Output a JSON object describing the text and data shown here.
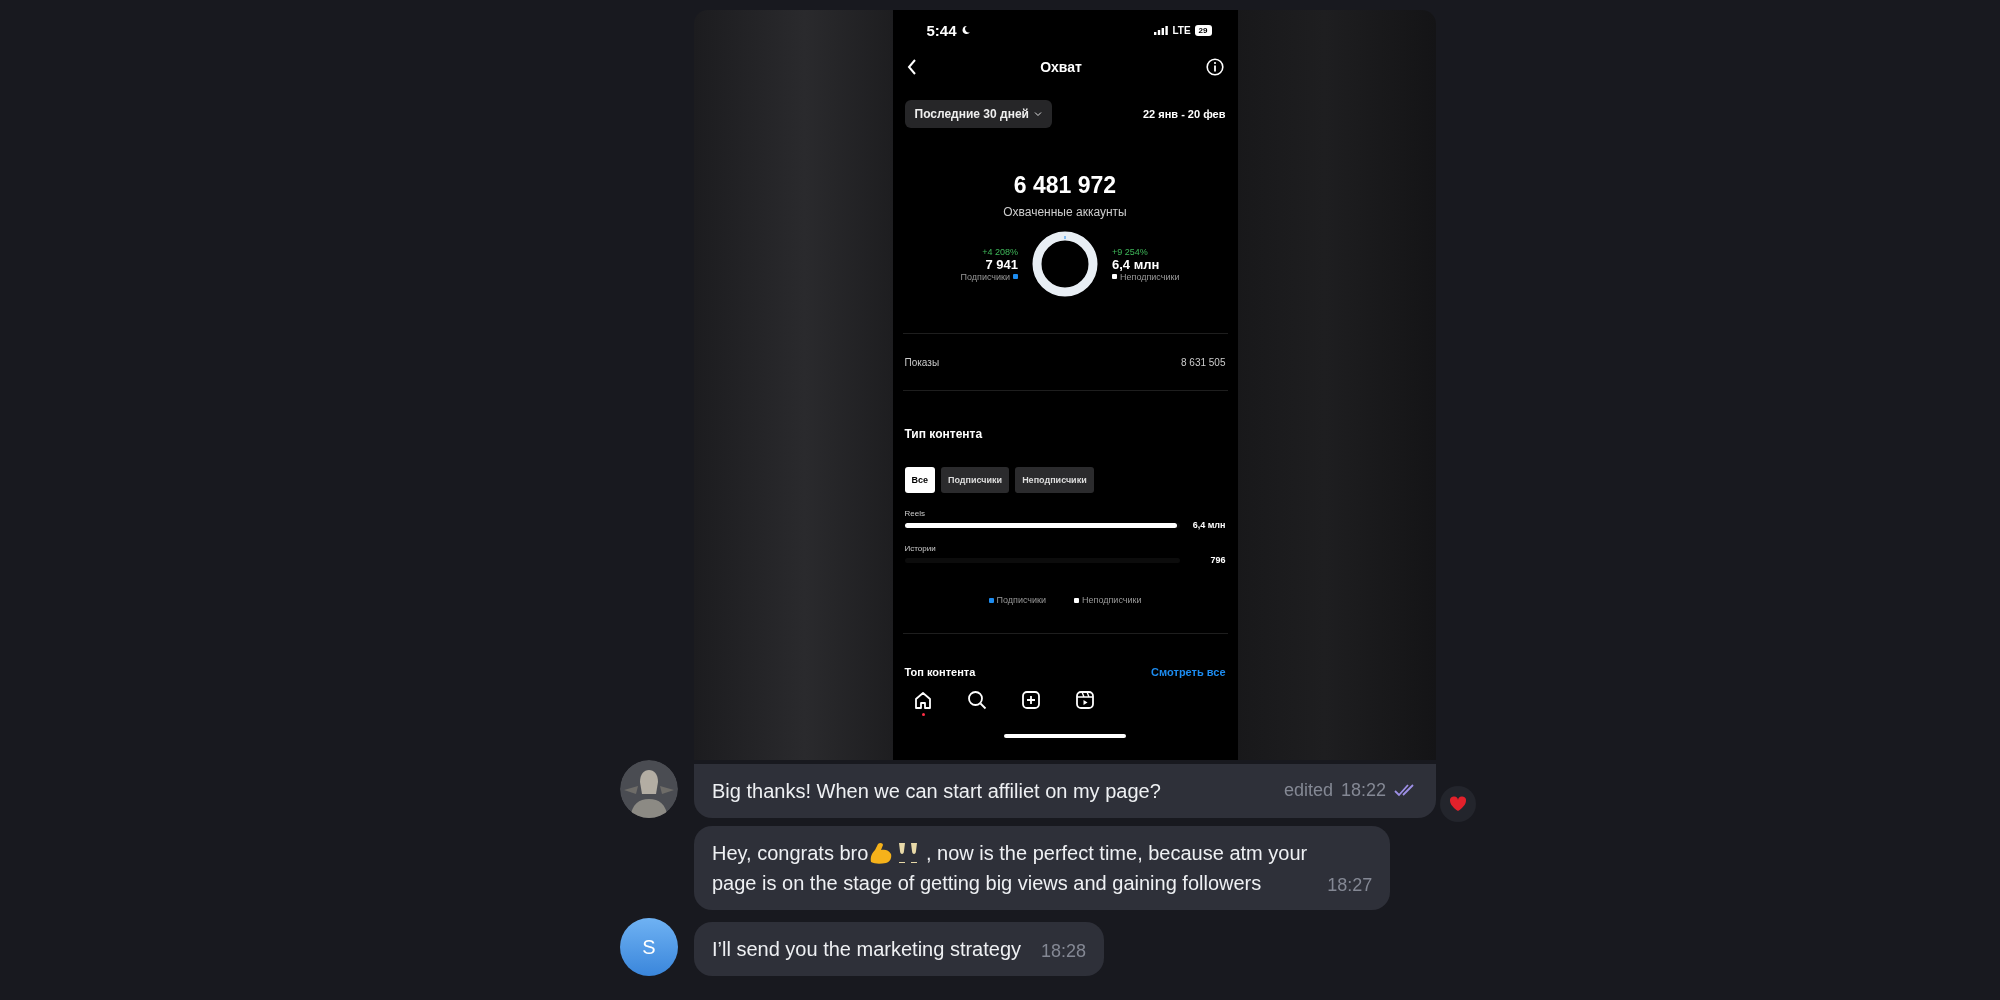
{
  "media": {
    "phone": {
      "status_bar": {
        "time": "5:44",
        "network": "LTE",
        "battery": "29"
      },
      "header": {
        "title": "Охват"
      },
      "period": {
        "label": "Последние 30 дней",
        "range": "22 янв - 20 фев"
      },
      "summary": {
        "value": "6 481 972",
        "label": "Охваченные аккаунты",
        "followers": {
          "change": "+4 208%",
          "value": "7 941",
          "label": "Подписчики",
          "color": "#1d8cf0"
        },
        "non_followers": {
          "change": "+9 254%",
          "value": "6,4 млн",
          "label": "Неподписчики",
          "color": "#ffffff"
        }
      },
      "impressions": {
        "label": "Показы",
        "value": "8 631 505"
      },
      "content_type": {
        "title": "Тип контента",
        "tabs": [
          {
            "label": "Все",
            "selected": true
          },
          {
            "label": "Подписчики",
            "selected": false
          },
          {
            "label": "Неподписчики",
            "selected": false
          }
        ],
        "bars": [
          {
            "label": "Reels",
            "value": "6,4 млн",
            "level": 0.99
          },
          {
            "label": "Истории",
            "value": "796"
          }
        ],
        "legend": [
          {
            "label": "Подписчики",
            "color": "#1d8cf0"
          },
          {
            "label": "Неподписчики",
            "color": "#ffffff"
          }
        ]
      },
      "top_content": {
        "title": "Топ контента",
        "link": "Смотреть все"
      },
      "nav": [
        {
          "kind": "home",
          "notification": true
        },
        {
          "kind": "search",
          "notification": false
        },
        {
          "kind": "create",
          "notification": false
        },
        {
          "kind": "reels",
          "notification": false
        }
      ]
    }
  },
  "messages": [
    {
      "avatar": {
        "kind": "picture"
      },
      "lines": [
        [
          {
            "kind": "text",
            "text": "Big thanks! When we can start affiliet on my page?"
          }
        ]
      ],
      "edited": "edited",
      "time": "18:22",
      "read": true,
      "reaction": true
    },
    {
      "lines": [
        [
          {
            "kind": "text",
            "text": "Hey, congrats bro"
          },
          {
            "kind": "arm"
          },
          {
            "kind": "glasses"
          },
          {
            "kind": "text",
            "text": " , now is the perfect time, because atm your"
          }
        ],
        [
          {
            "kind": "text",
            "text": "page is on the stage of getting big views and gaining followers"
          }
        ]
      ],
      "time": "18:27",
      "read": false,
      "reaction": false
    },
    {
      "avatar": {
        "kind": "letter",
        "letter": "S"
      },
      "lines": [
        [
          {
            "kind": "text",
            "text": "I’ll send you the marketing strategy"
          }
        ]
      ],
      "time": "18:28",
      "read": false,
      "reaction": false
    }
  ]
}
